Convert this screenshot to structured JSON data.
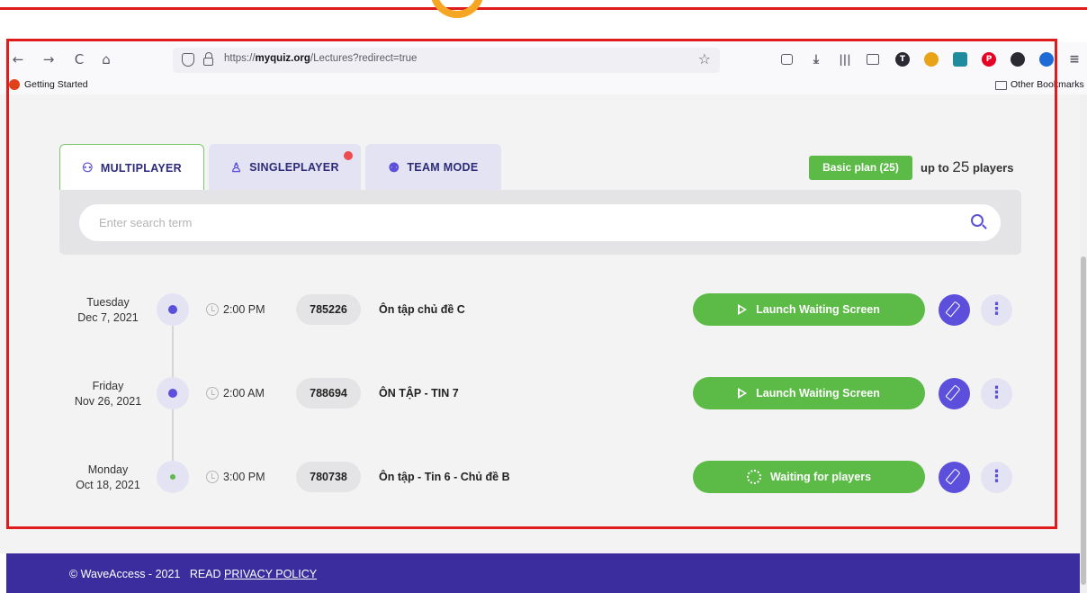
{
  "browser": {
    "url_domain": "myquiz.org",
    "url_prefix": "https://",
    "url_path": "/Lectures?redirect=true",
    "bookmark_getting_started": "Getting Started",
    "bookmark_other": "Other Bookmarks",
    "nav": {
      "back": "←",
      "forward": "→",
      "reload": "C",
      "home": "⌂"
    },
    "star": "☆"
  },
  "tabs": {
    "multiplayer": "MULTIPLAYER",
    "singleplayer": "SINGLEPLAYER",
    "team_mode": "TEAM MODE"
  },
  "plan": {
    "badge": "Basic plan (25)",
    "limit_prefix": "up to",
    "limit_number": "25",
    "limit_suffix": "players"
  },
  "search": {
    "placeholder": "Enter search term"
  },
  "lectures": [
    {
      "weekday": "Tuesday",
      "date": "Dec 7, 2021",
      "time": "2:00 PM",
      "code": "785226",
      "title": "Ôn tập chủ đề C",
      "action": "Launch Waiting Screen",
      "status": "scheduled"
    },
    {
      "weekday": "Friday",
      "date": "Nov 26, 2021",
      "time": "2:00 AM",
      "code": "788694",
      "title": "ÔN TẬP - TIN 7",
      "action": "Launch Waiting Screen",
      "status": "scheduled"
    },
    {
      "weekday": "Monday",
      "date": "Oct 18, 2021",
      "time": "3:00 PM",
      "code": "780738",
      "title": "Ôn tập - Tin 6 - Chủ đề B",
      "action": "Waiting for players",
      "status": "waiting"
    }
  ],
  "more_glyph": "⋮",
  "footer": {
    "copyright": "© WaveAccess - 2021",
    "read": "READ",
    "privacy": "PRIVACY POLICY"
  },
  "colors": {
    "accent_purple": "#5b4fdc",
    "accent_green": "#5cba47",
    "footer_bg": "#3b2d9e",
    "annotation_red": "#e01b1b"
  }
}
